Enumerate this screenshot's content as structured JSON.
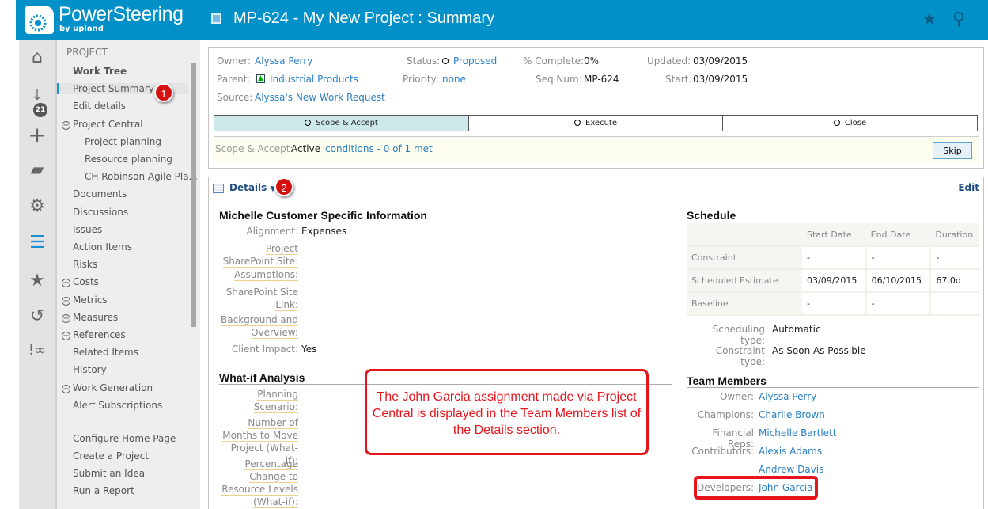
{
  "header": {
    "brand": "PowerSteering",
    "brand_sub": "by upland",
    "title": "MP-624 - My New Project : Summary",
    "icons": [
      "star-icon",
      "location-pin-icon"
    ]
  },
  "rail": {
    "icons": [
      "home-icon",
      "inbox-icon",
      "plus-icon",
      "search-folder-icon",
      "gear-icon",
      "work-tree-icon",
      "star-icon",
      "history-icon",
      "alert-link-icon"
    ],
    "inbox_count": "21"
  },
  "nav": {
    "section": "PROJECT",
    "items": [
      {
        "label": "Work Tree",
        "bold": true
      },
      {
        "label": "Project Summary",
        "active": true
      },
      {
        "label": "Edit details"
      },
      {
        "label": "Project Central",
        "toggle": "minus"
      },
      {
        "label": "Project planning",
        "sub": true
      },
      {
        "label": "Resource planning",
        "sub": true
      },
      {
        "label": "CH Robinson Agile Pla...",
        "sub": true
      },
      {
        "label": "Documents"
      },
      {
        "label": "Discussions"
      },
      {
        "label": "Issues"
      },
      {
        "label": "Action Items"
      },
      {
        "label": "Risks"
      },
      {
        "label": "Costs",
        "toggle": "plus"
      },
      {
        "label": "Metrics",
        "toggle": "plus"
      },
      {
        "label": "Measures",
        "toggle": "plus"
      },
      {
        "label": "References",
        "toggle": "plus"
      },
      {
        "label": "Related Items"
      },
      {
        "label": "History"
      },
      {
        "label": "Work Generation",
        "toggle": "plus"
      },
      {
        "label": "Alert Subscriptions"
      }
    ],
    "footer": [
      "Configure Home Page",
      "Create a Project",
      "Submit an Idea",
      "Run a Report"
    ]
  },
  "badges": {
    "one": "1",
    "two": "2"
  },
  "summary": {
    "owner_label": "Owner:",
    "owner": "Alyssa Perry",
    "parent_label": "Parent:",
    "parent": "Industrial Products",
    "source_label": "Source:",
    "source": "Alyssa's New Work Request",
    "status_label": "Status:",
    "status": "Proposed",
    "priority_label": "Priority:",
    "priority": "none",
    "complete_label": "% Complete:",
    "complete": "0%",
    "seq_label": "Seq Num:",
    "seq": "MP-624",
    "updated_label": "Updated:",
    "updated": "03/09/2015",
    "start_label": "Start:",
    "start": "03/09/2015",
    "stages": [
      "Scope & Accept",
      "Execute",
      "Close"
    ],
    "gate_label": "Scope & Accept:",
    "gate_status": "Active",
    "conditions": "conditions - 0 of 1 met",
    "skip": "Skip"
  },
  "details": {
    "title": "Details",
    "edit": "Edit",
    "custom": {
      "title": "Michelle Customer Specific Information",
      "fields": [
        {
          "label": "Alignment:",
          "value": "Expenses"
        },
        {
          "label": "Project SharePoint Site:",
          "value": ""
        },
        {
          "label": "Assumptions:",
          "value": ""
        },
        {
          "label": "SharePoint Site Link:",
          "value": ""
        },
        {
          "label": "Background and Overview:",
          "value": ""
        },
        {
          "label": "Client Impact:",
          "value": "Yes"
        }
      ]
    },
    "whatif": {
      "title": "What-if Analysis",
      "fields": [
        "Planning Scenario:",
        "Number of Months to Move Project (What-if):",
        "Percentage Change to Resource Levels (What-if):"
      ]
    },
    "schedule": {
      "title": "Schedule",
      "columns": [
        "Start Date",
        "End Date",
        "Duration"
      ],
      "rows": [
        {
          "label": "Constraint",
          "cells": [
            "-",
            "-",
            "-"
          ]
        },
        {
          "label": "Scheduled Estimate",
          "cells": [
            "03/09/2015",
            "06/10/2015",
            "67.0d"
          ]
        },
        {
          "label": "Baseline",
          "cells": [
            "-",
            "-",
            ""
          ]
        }
      ],
      "scheduling_type_label": "Scheduling type:",
      "scheduling_type": "Automatic",
      "constraint_type_label": "Constraint type:",
      "constraint_type": "As Soon As Possible"
    },
    "team": {
      "title": "Team Members",
      "rows": [
        {
          "label": "Owner:",
          "value": "Alyssa Perry"
        },
        {
          "label": "Champions:",
          "value": "Charlie Brown"
        },
        {
          "label": "Financial Reps:",
          "value": "Michelle Bartlett"
        },
        {
          "label": "Contributors:",
          "value": "Alexis Adams"
        },
        {
          "label": "",
          "value": "Andrew Davis"
        },
        {
          "label": "Developers:",
          "value": "John Garcia"
        }
      ]
    }
  },
  "callout": "The John Garcia assignment made via Project Central is displayed in the Team Members list of the Details section.",
  "colors": {
    "header": "#0290c9",
    "link": "#2a7fc4",
    "annotation": "#e8141c",
    "active_stage": "#cde9ea"
  }
}
